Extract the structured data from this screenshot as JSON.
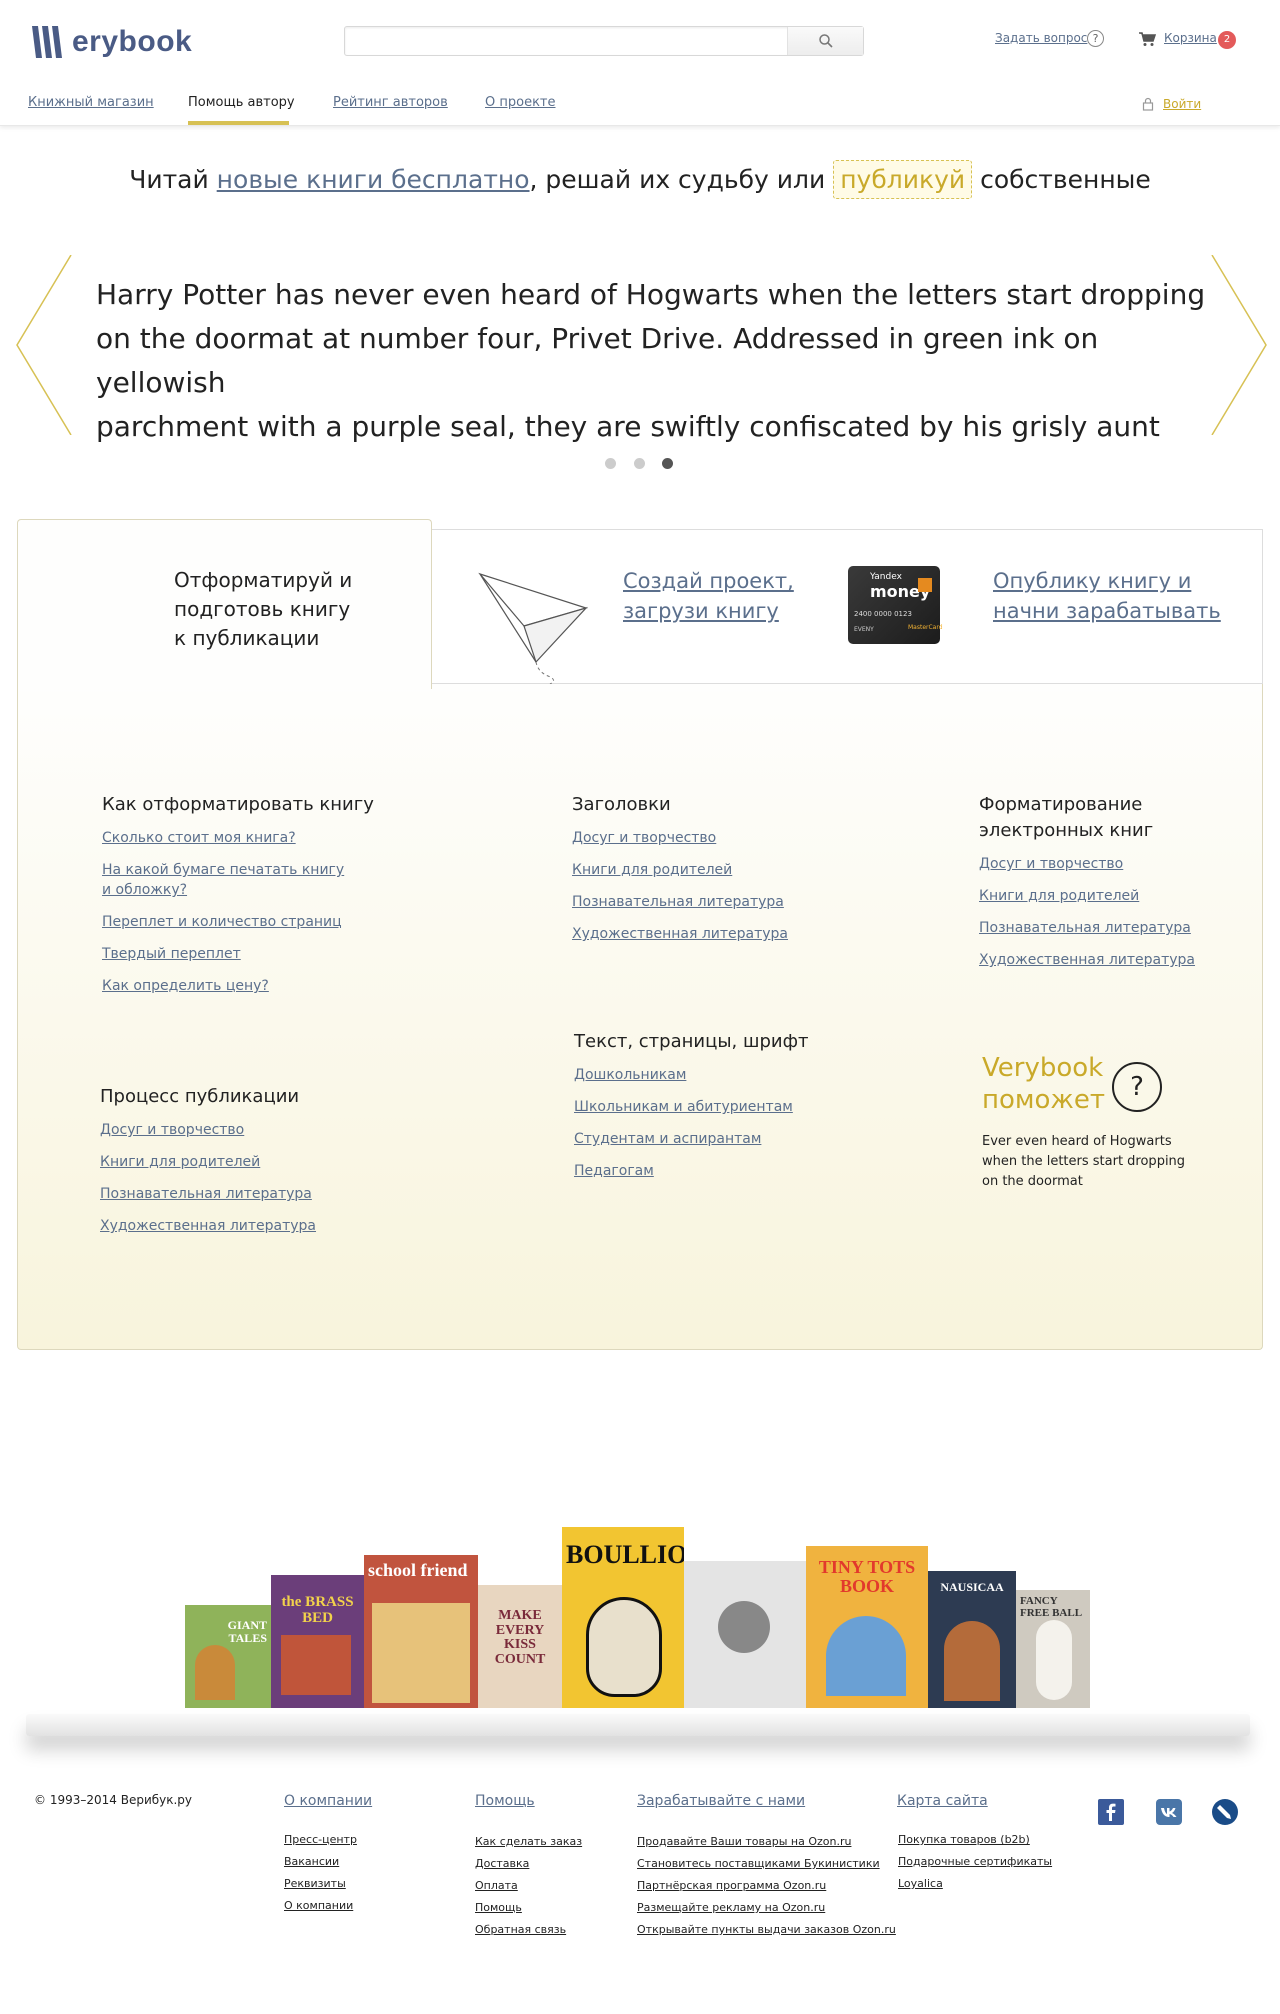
{
  "header": {
    "logo_text": "erybook",
    "search_placeholder": "",
    "ask_label": "Задать вопрос",
    "ask_icon": "?",
    "cart_label": "Корзина",
    "cart_count": "2",
    "login_label": "Войти"
  },
  "nav": {
    "items": [
      {
        "label": "Книжный магазин"
      },
      {
        "label": "Помощь автору"
      },
      {
        "label": "Рейтинг авторов"
      },
      {
        "label": "О проекте"
      }
    ],
    "active_index": 1
  },
  "tagline": {
    "before": "Читай ",
    "link": "новые книги бесплатно",
    "middle": ", решай их судьбу или ",
    "boxed": "публикуй",
    "after": " собственные"
  },
  "carousel": {
    "quote_line1": "Harry Potter has never even heard of Hogwarts when the letters  start dropping",
    "quote_line2": "on the doormat at number four, Privet  Drive. Addressed in green ink on yellowish",
    "quote_line3": "parchment with a purple seal, they are swiftly confiscated by his grisly aunt",
    "dots": 3,
    "active_dot": 2
  },
  "tabs": {
    "tab1": {
      "line1": "Отформатируй и",
      "line2": "подготовь книгу",
      "line3": "к публикации"
    },
    "tab2": {
      "line1": "Создай проект,",
      "line2": "загрузи книгу"
    },
    "tab3": {
      "line1": "Опублику книгу и ",
      "line2": "начни зарабатывать"
    },
    "card": {
      "brand": "Yandex",
      "name": "money",
      "number": "2400 0000 0123",
      "holder": "ЕVENY",
      "mc": "MasterCard"
    }
  },
  "sections": {
    "format_book": {
      "title": "Как отформатировать книгу",
      "links": [
        "Сколько стоит моя книга?",
        "На какой бумаге печатать книгу",
        "и обложку?",
        "Переплет и количество страниц",
        "Твердый переплет",
        "Как определить цену?"
      ]
    },
    "headings": {
      "title": "Заголовки",
      "links": [
        "Досуг и творчество",
        "Книги для родителей",
        "Познавательная литература",
        "Художественная литература"
      ]
    },
    "ebook": {
      "title1": "Форматирование",
      "title2": "электронных книг",
      "links": [
        "Досуг и творчество",
        "Книги для родителей",
        "Познавательная литература",
        "Художественная литература"
      ]
    },
    "text_pages": {
      "title": "Текст, страницы, шрифт",
      "links": [
        "Дошкольникам",
        "Школьникам и абитуриентам",
        "Студентам и аспирантам",
        "Педагогам"
      ]
    },
    "process": {
      "title": "Процесс публикации",
      "links": [
        "Досуг и творчество",
        "Книги для родителей",
        "Познавательная литература",
        "Художественная литература"
      ]
    },
    "help": {
      "title1": "Verybook",
      "title2": "поможет",
      "icon": "?",
      "text": "Ever even heard of Hogwarts when the letters start dropping on the doormat"
    }
  },
  "books": [
    {
      "title": "GIANT TALES",
      "color": "#8fb35a"
    },
    {
      "title": "the BRASS BED",
      "color": "#6b3e7a"
    },
    {
      "title": "school friend",
      "color": "#c1543e"
    },
    {
      "title": "MAKE EVERY KISS COUNT",
      "color": "#e8d6c0"
    },
    {
      "title": "BOULLION",
      "color": "#f2c531"
    },
    {
      "title": "",
      "color": "#e4e4e4"
    },
    {
      "title": "TINY TOTS BOOK",
      "color": "#f0b33f"
    },
    {
      "title": "NAUSICAA",
      "color": "#2d3b52"
    },
    {
      "title": "FANCY FREE BALL",
      "color": "#cfcac0"
    }
  ],
  "footer": {
    "copyright": "© 1993–2014 Верибук.ру",
    "columns": [
      {
        "head": "О компании",
        "links": [
          "Пресс-центр",
          "Вакансии",
          "Реквизиты",
          "О компании"
        ]
      },
      {
        "head": "Помощь",
        "links": [
          "Как сделать заказ",
          "Доставка",
          "Оплата",
          "Помощь",
          "Обратная связь"
        ]
      },
      {
        "head": "Зарабатывайте с нами",
        "links": [
          "Продавайте Ваши товары на Ozon.ru",
          "Становитесь поставщиками Букинистики",
          "Партнёрская программа Ozon.ru",
          "Размещайте рекламу на Ozon.ru",
          "Открывайте пункты выдачи заказов Ozon.ru"
        ]
      },
      {
        "head": "Карта сайта",
        "links": [
          "Покупка товаров (b2b)",
          "Подарочные сертификаты",
          "Loyalica"
        ]
      }
    ],
    "social": [
      "facebook-icon",
      "vk-icon",
      "livejournal-icon"
    ]
  },
  "colors": {
    "accent": "#d7c154",
    "link": "#5b6f8c",
    "badge": "#e35a5a"
  }
}
